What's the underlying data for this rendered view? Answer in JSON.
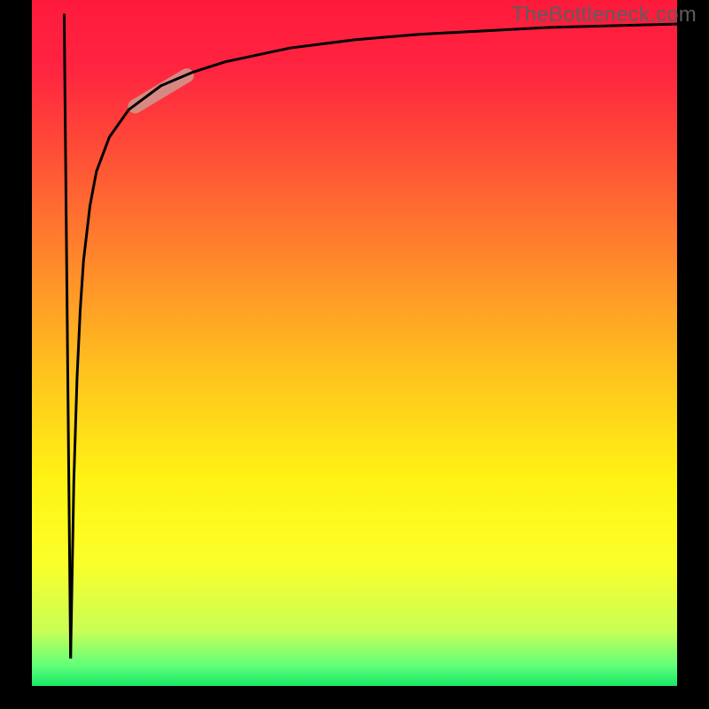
{
  "watermark": "TheBottleneck.com",
  "chart_data": {
    "type": "line",
    "title": "",
    "xlabel": "",
    "ylabel": "",
    "xlim": [
      0,
      100
    ],
    "ylim": [
      0,
      100
    ],
    "grid": false,
    "legend": false,
    "background_gradient": {
      "orientation": "vertical",
      "stops": [
        {
          "offset": 0.0,
          "color": "#ff1a3c"
        },
        {
          "offset": 0.1,
          "color": "#ff2440"
        },
        {
          "offset": 0.2,
          "color": "#ff4638"
        },
        {
          "offset": 0.4,
          "color": "#ff8f2a"
        },
        {
          "offset": 0.55,
          "color": "#ffc51d"
        },
        {
          "offset": 0.7,
          "color": "#fff314"
        },
        {
          "offset": 0.82,
          "color": "#fbff2a"
        },
        {
          "offset": 0.92,
          "color": "#c8ff55"
        },
        {
          "offset": 0.97,
          "color": "#62ff7a"
        },
        {
          "offset": 1.0,
          "color": "#19e765"
        }
      ]
    },
    "series": [
      {
        "name": "down-stroke",
        "color": "#000000",
        "width": 3,
        "x": [
          5.0,
          6.0
        ],
        "y": [
          98,
          4
        ]
      },
      {
        "name": "bottleneck-curve",
        "color": "#000000",
        "width": 3,
        "x": [
          6.0,
          6.5,
          7,
          7.5,
          8,
          9,
          10,
          12,
          15,
          20,
          25,
          30,
          40,
          50,
          60,
          80,
          100
        ],
        "y": [
          4,
          30,
          45,
          55,
          62,
          70,
          75,
          80,
          84,
          87.5,
          89.5,
          91,
          93,
          94.2,
          95,
          96,
          96.5
        ]
      }
    ],
    "highlight": {
      "name": "marker-segment",
      "color": "#d2948a",
      "width": 16,
      "linecap": "round",
      "opacity": 0.9,
      "x": [
        16,
        24
      ],
      "y": [
        84.5,
        89
      ]
    },
    "frame": {
      "color": "#000000",
      "left_right_width": 36,
      "bottom_width": 26,
      "top_width": 0
    }
  }
}
